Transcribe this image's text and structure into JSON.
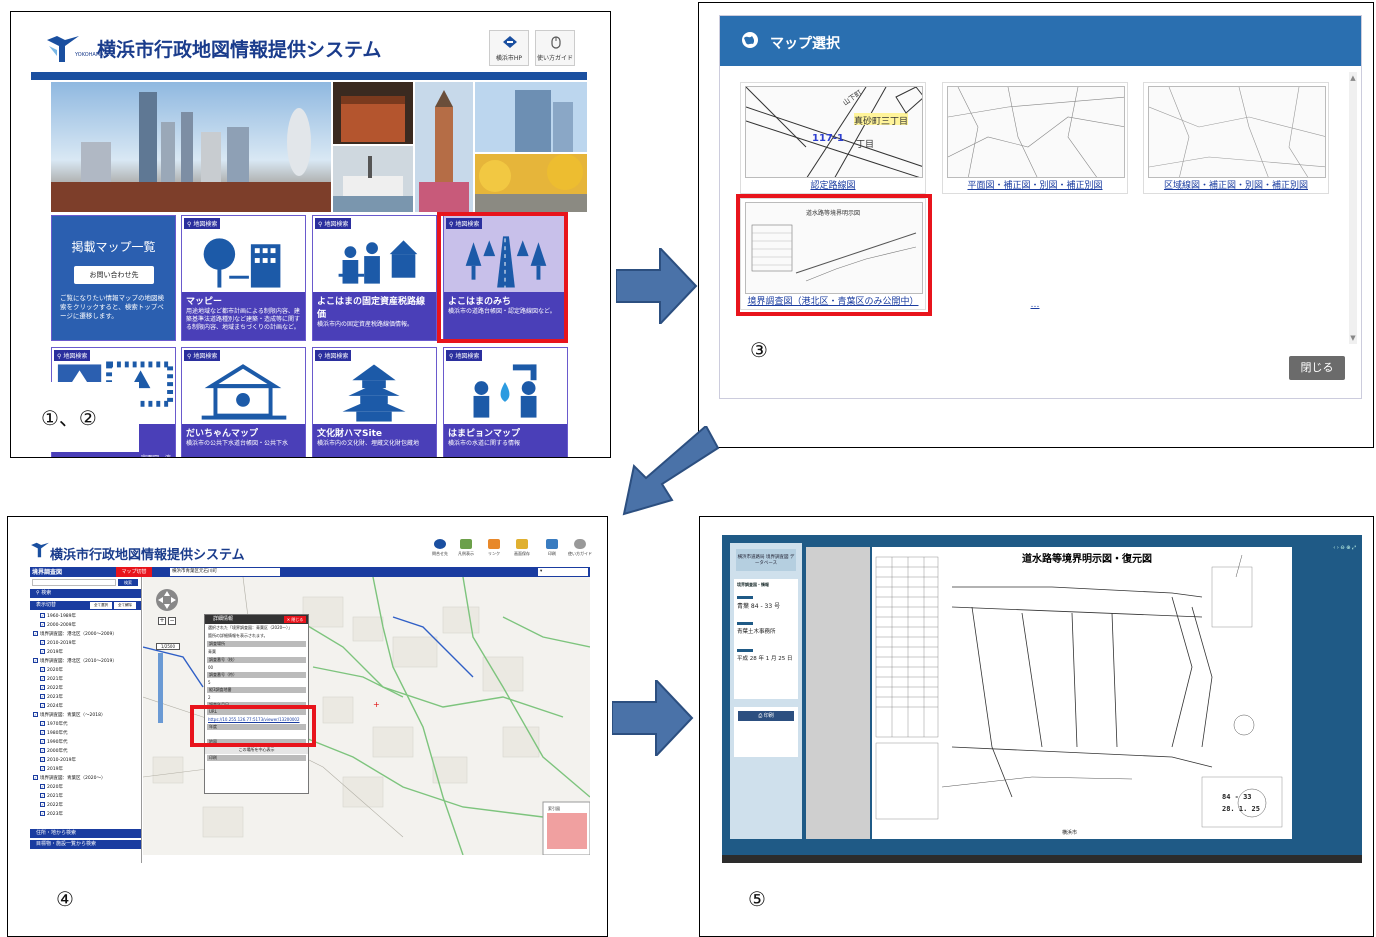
{
  "panel1": {
    "logo_sub": "YOKOHAMA",
    "site_title": "横浜市行政地図情報提供システム",
    "header_buttons": [
      "横浜市HP",
      "使い方ガイド"
    ],
    "lead_tile": {
      "title": "掲載マップ一覧",
      "button": "お問い合わせ先",
      "desc": "ご覧になりたい情報マップの地図検索をクリックすると、検索トップページに遷移します。"
    },
    "tag": "地図検索",
    "tiles_row1": [
      {
        "title": "マッピー",
        "desc": "用途地域など都市計画による制限内容、建築基準法道路種別など建築・造成等に関する制限内容、地域まちづくりの計画など。"
      },
      {
        "title": "よこはまの固定資産税路線価",
        "desc": "横浜市内の固定資産税路線価情報。"
      },
      {
        "title": "よこはまのみち",
        "desc": "横浜市の道路台帳図・認定路線図など。"
      }
    ],
    "tiles_row2": [
      {
        "title": "",
        "desc": "定面図、液"
      },
      {
        "title": "だいちゃんマップ",
        "desc": "横浜市の公共下水道台帳図・公共下水"
      },
      {
        "title": "文化財ハマSite",
        "desc": "横浜市内の文化財、埋蔵文化財包蔵地"
      },
      {
        "title": "はまピョンマップ",
        "desc": "横浜市の水道に関する情報"
      }
    ],
    "step_label": "①、②"
  },
  "panel2": {
    "title": "マップ選択",
    "cards": [
      "認定路線図",
      "平面図・補正図・別図・補正別図",
      "区域線図・補正図・別図・補正別図",
      "境界調査図（港北区・青葉区のみ公開中）",
      "…"
    ],
    "thumb_text": [
      "真砂町三丁目",
      "117-1",
      "丁目",
      "山下町"
    ],
    "close": "閉じる",
    "step_label": "③"
  },
  "panel4": {
    "site_title": "横浜市行政地図情報提供システム",
    "sidebar_title": "境界調査図",
    "toolbar": [
      "問合せ先",
      "凡例表示",
      "リンク",
      "画面保存",
      "印刷",
      "使い方ガイド"
    ],
    "map_tab": "マップ切替",
    "address": "横浜市青葉区元石川町",
    "search_btn": "検索",
    "sections": [
      "表示切替",
      "全て選択",
      "全て解除"
    ],
    "layers": [
      "1960-1989年",
      "2000-2009年",
      "境界調査図：港北区（2000～2009）",
      "2010-2019年",
      "2019年",
      "境界調査図：港北区（2010～2019）",
      "2020年",
      "2021年",
      "2022年",
      "2023年",
      "2024年",
      "境界調査図：青葉区（～2018）",
      "1970年代",
      "1980年代",
      "1990年代",
      "2000年代",
      "2010-2019年",
      "2019年",
      "境界調査図：青葉区（2020～）",
      "2020年",
      "2021年",
      "2022年",
      "2023年"
    ],
    "bottom_bands": [
      "住所・地から検索",
      "目標物・施設一覧から検索"
    ],
    "popup": {
      "title": "詳細情報",
      "close": "閉じる",
      "rows": [
        "選択された「境界調査図：青葉区（2020～）」",
        "箇所の詳細情報を表示されます。",
        "調査場所",
        "青葉",
        "調査番号（枝）",
        "00",
        "調査番号（符）",
        "5",
        "縦3調査地番",
        "2",
        "調査年月日",
        "URL",
        "https://10.255.126.77:5173/viewer/13200002",
        "年度",
        "地図",
        "この場所を中心表示",
        "印刷"
      ]
    },
    "scale": "1/2500",
    "step_label": "④"
  },
  "panel5": {
    "side_title": "横浜市道路局 境界調査図 データベース",
    "side_rows": [
      "境界調査図・情報",
      "青葉 84 - 33 号",
      "青葉土木事務所",
      "平成 28 年 1 月 25 日"
    ],
    "print_btn": "印刷",
    "doc_title": "道水路等境界明示図・復元図",
    "doc_numbers": [
      "84 - 33",
      "28. 1. 25"
    ],
    "doc_foot": "横浜市",
    "step_label": "⑤"
  }
}
